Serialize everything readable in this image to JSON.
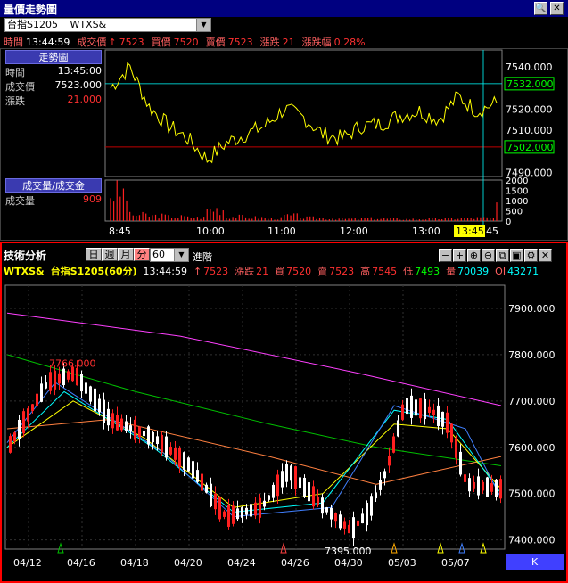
{
  "top": {
    "title": "量價走勢圖",
    "symbol": "台指S1205",
    "code": "WTXS&",
    "info": [
      {
        "label": "時間",
        "value": "13:44:59",
        "color": "#ffffff"
      },
      {
        "label": "成交價",
        "value": "7523",
        "arrow": "↑",
        "color": "#ff3030"
      },
      {
        "label": "買價",
        "value": "7520",
        "color": "#ff3030"
      },
      {
        "label": "賣價",
        "value": "7523",
        "color": "#ff3030"
      },
      {
        "label": "漲跌",
        "value": "21",
        "color": "#ff3030"
      },
      {
        "label": "漲跌幅",
        "value": "0.28%",
        "color": "#ff3030"
      }
    ],
    "left_panel": {
      "header": "走勢圖",
      "rows": [
        {
          "label": "時間",
          "value": "13:45:00"
        },
        {
          "label": "成交價",
          "value": "7523.000"
        },
        {
          "label": "漲跌",
          "value": "21.000"
        }
      ],
      "volume_header": "成交量/成交金",
      "volume_row": {
        "label": "成交量",
        "value": "909"
      }
    },
    "price_axis": [
      "7540.000",
      "7532.000",
      "7520.000",
      "7510.000",
      "7502.000",
      "7490.000"
    ],
    "price_boxes": {
      "current": "7532.000",
      "reference": "7502.000"
    },
    "volume_axis": [
      "2000",
      "1500",
      "1000",
      "500",
      "0"
    ],
    "time_axis": [
      "8:45",
      "10:00",
      "11:00",
      "12:00",
      "13:00",
      "13:45",
      "45"
    ],
    "accent": "#00ffff",
    "ref_line_color": "#c00000"
  },
  "bottom": {
    "title": "技術分析",
    "period_tabs": [
      "日",
      "週",
      "月",
      "分"
    ],
    "active_tab": "分",
    "interval": "60",
    "advanced_label": "進階",
    "info": [
      {
        "label": "WTXS&",
        "value": "",
        "color": "#ffff00"
      },
      {
        "label": "台指S1205(60分)",
        "value": "",
        "color": "#ffff00"
      },
      {
        "label": "13:44:59",
        "value": "",
        "color": "#ffffff"
      },
      {
        "label": "↑",
        "value": "7523",
        "color": "#ff3030"
      },
      {
        "label": "漲跌",
        "value": "21",
        "color": "#ff3030"
      },
      {
        "label": "買",
        "value": "7520",
        "color": "#ff3030"
      },
      {
        "label": "賣",
        "value": "7523",
        "color": "#ff3030"
      },
      {
        "label": "高",
        "value": "7545",
        "color": "#ff3030"
      },
      {
        "label": "低",
        "value": "7493",
        "color": "#00ff00"
      },
      {
        "label": "量",
        "value": "70039",
        "color": "#00ffff"
      },
      {
        "label": "OI",
        "value": "43271",
        "color": "#00ffff"
      }
    ],
    "price_axis": [
      "7900.000",
      "7800.000",
      "7700.000",
      "7600.000",
      "7500.000",
      "7400.000"
    ],
    "annotations": {
      "high": "7766.000",
      "low": "7395.000"
    },
    "date_axis": [
      "04/12",
      "04/16",
      "04/18",
      "04/20",
      "04/24",
      "04/26",
      "04/30",
      "05/03",
      "05/07"
    ],
    "corner_label": "K"
  },
  "chart_data": [
    {
      "type": "line",
      "title": "走勢圖",
      "x": [
        "8:45",
        "9:00",
        "9:15",
        "9:30",
        "9:45",
        "10:00",
        "10:15",
        "10:30",
        "10:45",
        "11:00",
        "11:15",
        "11:30",
        "11:45",
        "12:00",
        "12:15",
        "12:30",
        "12:45",
        "13:00",
        "13:15",
        "13:30",
        "13:45"
      ],
      "series": [
        {
          "name": "成交價",
          "values": [
            7530,
            7540,
            7521,
            7512,
            7506,
            7496,
            7504,
            7508,
            7512,
            7520,
            7516,
            7508,
            7506,
            7512,
            7513,
            7517,
            7519,
            7515,
            7526,
            7519,
            7523
          ]
        }
      ],
      "reference_line": 7502,
      "ylim": [
        7488,
        7548
      ]
    },
    {
      "type": "bar",
      "title": "成交量/成交金",
      "series": [
        {
          "name": "成交量",
          "values": [
            1600,
            350,
            300,
            250,
            200,
            700,
            250,
            200,
            150,
            300,
            180,
            150,
            120,
            150,
            130,
            110,
            120,
            140,
            160,
            180,
            909
          ]
        }
      ],
      "ylim": [
        0,
        2000
      ]
    },
    {
      "type": "candlestick",
      "title": "技術分析",
      "categories": [
        "04/12",
        "04/16",
        "04/18",
        "04/20",
        "04/24",
        "04/26",
        "04/30",
        "05/03",
        "05/07"
      ],
      "ylim": [
        7380,
        7950
      ],
      "annotations": [
        {
          "label": "7766.000",
          "value": 7766
        },
        {
          "label": "7395.000",
          "value": 7395
        }
      ]
    }
  ]
}
